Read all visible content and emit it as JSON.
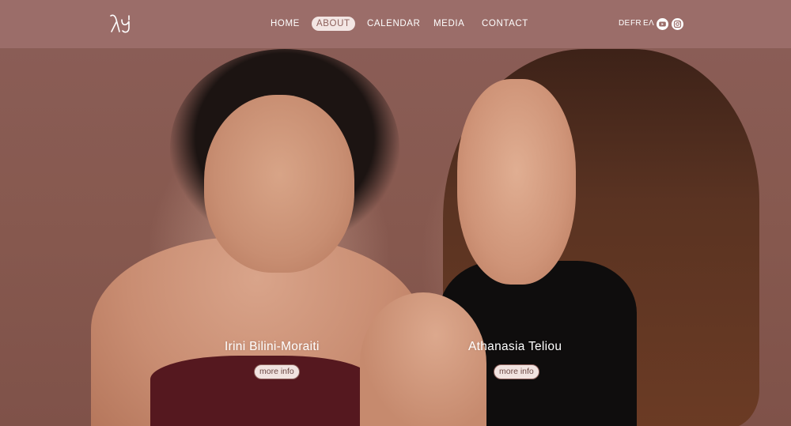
{
  "header": {
    "logo_text": "λy",
    "nav": [
      {
        "label": "HOME",
        "active": false
      },
      {
        "label": "ABOUT",
        "active": true
      },
      {
        "label": "CALENDAR",
        "active": false
      },
      {
        "label": "MEDIA",
        "active": false
      },
      {
        "label": "CONTACT",
        "active": false
      }
    ],
    "languages": [
      "DE",
      "FR",
      "ΕΛ"
    ],
    "social": [
      {
        "icon": "youtube-icon"
      },
      {
        "icon": "instagram-icon"
      }
    ]
  },
  "people": [
    {
      "name": "Irini Bilini-Moraiti",
      "button": "more info"
    },
    {
      "name": "Athanasia Teliou",
      "button": "more info"
    }
  ],
  "colors": {
    "header_bg": "#9b6d69",
    "active_pill_bg": "#f3e6e4",
    "accent": "#8e615c"
  }
}
